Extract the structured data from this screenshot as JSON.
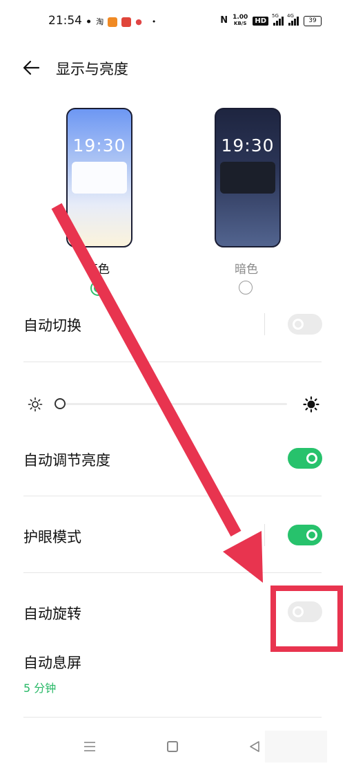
{
  "status_bar": {
    "time": "21:54",
    "app_icons": [
      "wechat-icon",
      "taobao-icon",
      "orange-app-icon",
      "red-app-icon",
      "map-pin-icon"
    ],
    "dot": "•",
    "nfc": "N",
    "net_speed_value": "1.00",
    "net_speed_unit": "KB/S",
    "hd_badge": "HD",
    "signal_1_label": "5G",
    "signal_2_label": "4G",
    "battery": "39"
  },
  "header": {
    "back_icon": "back-arrow-icon",
    "title": "显示与亮度"
  },
  "themes": {
    "light": {
      "clock": "19:30",
      "label": "亮色",
      "selected": true
    },
    "dark": {
      "clock": "19:30",
      "label": "暗色",
      "selected": false
    }
  },
  "settings": {
    "auto_switch": {
      "label": "自动切换",
      "enabled": false
    },
    "brightness": {
      "level_percent": 0
    },
    "auto_brightness": {
      "label": "自动调节亮度",
      "enabled": true
    },
    "eye_comfort": {
      "label": "护眼模式",
      "enabled": true
    },
    "auto_rotate": {
      "label": "自动旋转",
      "enabled": false
    },
    "screen_timeout": {
      "label": "自动息屏",
      "value": "5 分钟"
    }
  },
  "nav_bar": {
    "icons": [
      "menu-icon",
      "home-icon",
      "back-triangle-icon"
    ]
  },
  "colors": {
    "accent_green": "#27c26c",
    "annotation_red": "#e8344f"
  }
}
